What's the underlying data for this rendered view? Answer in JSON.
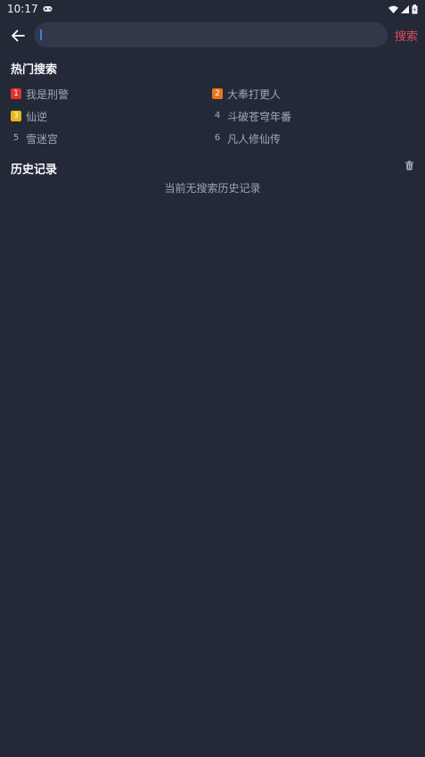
{
  "status_bar": {
    "time": "10:17",
    "icons": [
      "gamepad-icon",
      "wifi-icon",
      "cell-signal-icon",
      "battery-icon"
    ]
  },
  "search": {
    "value": "",
    "submit_label": "搜索",
    "accent_color": "#e0475e"
  },
  "hot": {
    "title": "热门搜索",
    "items": [
      {
        "rank": "1",
        "label": "我是刑警",
        "badge_color": "#e5302c"
      },
      {
        "rank": "2",
        "label": "大奉打更人",
        "badge_color": "#e8751a"
      },
      {
        "rank": "3",
        "label": "仙逆",
        "badge_color": "#e8b816"
      },
      {
        "rank": "4",
        "label": "斗破苍穹年番",
        "badge_color": ""
      },
      {
        "rank": "5",
        "label": "雪迷宫",
        "badge_color": ""
      },
      {
        "rank": "6",
        "label": "凡人修仙传",
        "badge_color": ""
      }
    ]
  },
  "history": {
    "title": "历史记录",
    "empty_text": "当前无搜索历史记录"
  }
}
